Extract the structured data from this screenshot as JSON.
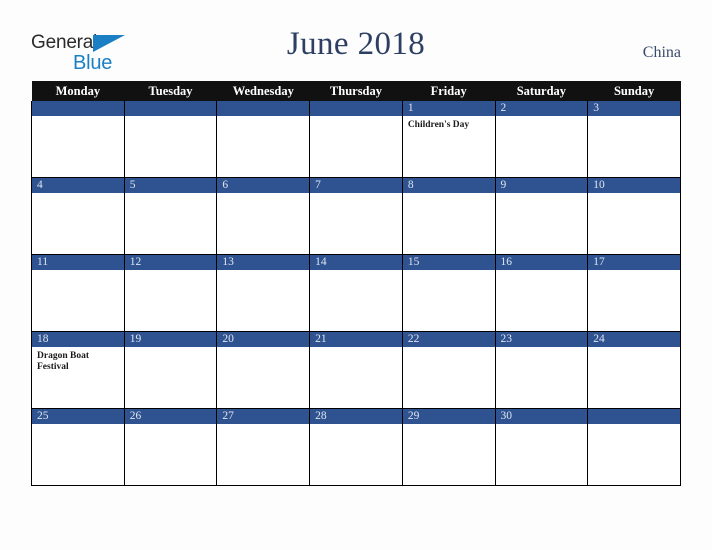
{
  "brand": {
    "name_part1": "General",
    "name_part2": "Blue",
    "color_dark": "#2b2b2b",
    "color_blue": "#1b7fc4"
  },
  "header": {
    "title": "June 2018",
    "country": "China",
    "title_color": "#2d3f63"
  },
  "calendar": {
    "accent_color": "#2f5390",
    "header_bg": "#111111",
    "weekdays": [
      "Monday",
      "Tuesday",
      "Wednesday",
      "Thursday",
      "Friday",
      "Saturday",
      "Sunday"
    ],
    "weeks": [
      [
        {
          "day": "",
          "event": ""
        },
        {
          "day": "",
          "event": ""
        },
        {
          "day": "",
          "event": ""
        },
        {
          "day": "",
          "event": ""
        },
        {
          "day": "1",
          "event": "Children's Day"
        },
        {
          "day": "2",
          "event": ""
        },
        {
          "day": "3",
          "event": ""
        }
      ],
      [
        {
          "day": "4",
          "event": ""
        },
        {
          "day": "5",
          "event": ""
        },
        {
          "day": "6",
          "event": ""
        },
        {
          "day": "7",
          "event": ""
        },
        {
          "day": "8",
          "event": ""
        },
        {
          "day": "9",
          "event": ""
        },
        {
          "day": "10",
          "event": ""
        }
      ],
      [
        {
          "day": "11",
          "event": ""
        },
        {
          "day": "12",
          "event": ""
        },
        {
          "day": "13",
          "event": ""
        },
        {
          "day": "14",
          "event": ""
        },
        {
          "day": "15",
          "event": ""
        },
        {
          "day": "16",
          "event": ""
        },
        {
          "day": "17",
          "event": ""
        }
      ],
      [
        {
          "day": "18",
          "event": "Dragon Boat Festival"
        },
        {
          "day": "19",
          "event": ""
        },
        {
          "day": "20",
          "event": ""
        },
        {
          "day": "21",
          "event": ""
        },
        {
          "day": "22",
          "event": ""
        },
        {
          "day": "23",
          "event": ""
        },
        {
          "day": "24",
          "event": ""
        }
      ],
      [
        {
          "day": "25",
          "event": ""
        },
        {
          "day": "26",
          "event": ""
        },
        {
          "day": "27",
          "event": ""
        },
        {
          "day": "28",
          "event": ""
        },
        {
          "day": "29",
          "event": ""
        },
        {
          "day": "30",
          "event": ""
        },
        {
          "day": "",
          "event": ""
        }
      ]
    ]
  }
}
